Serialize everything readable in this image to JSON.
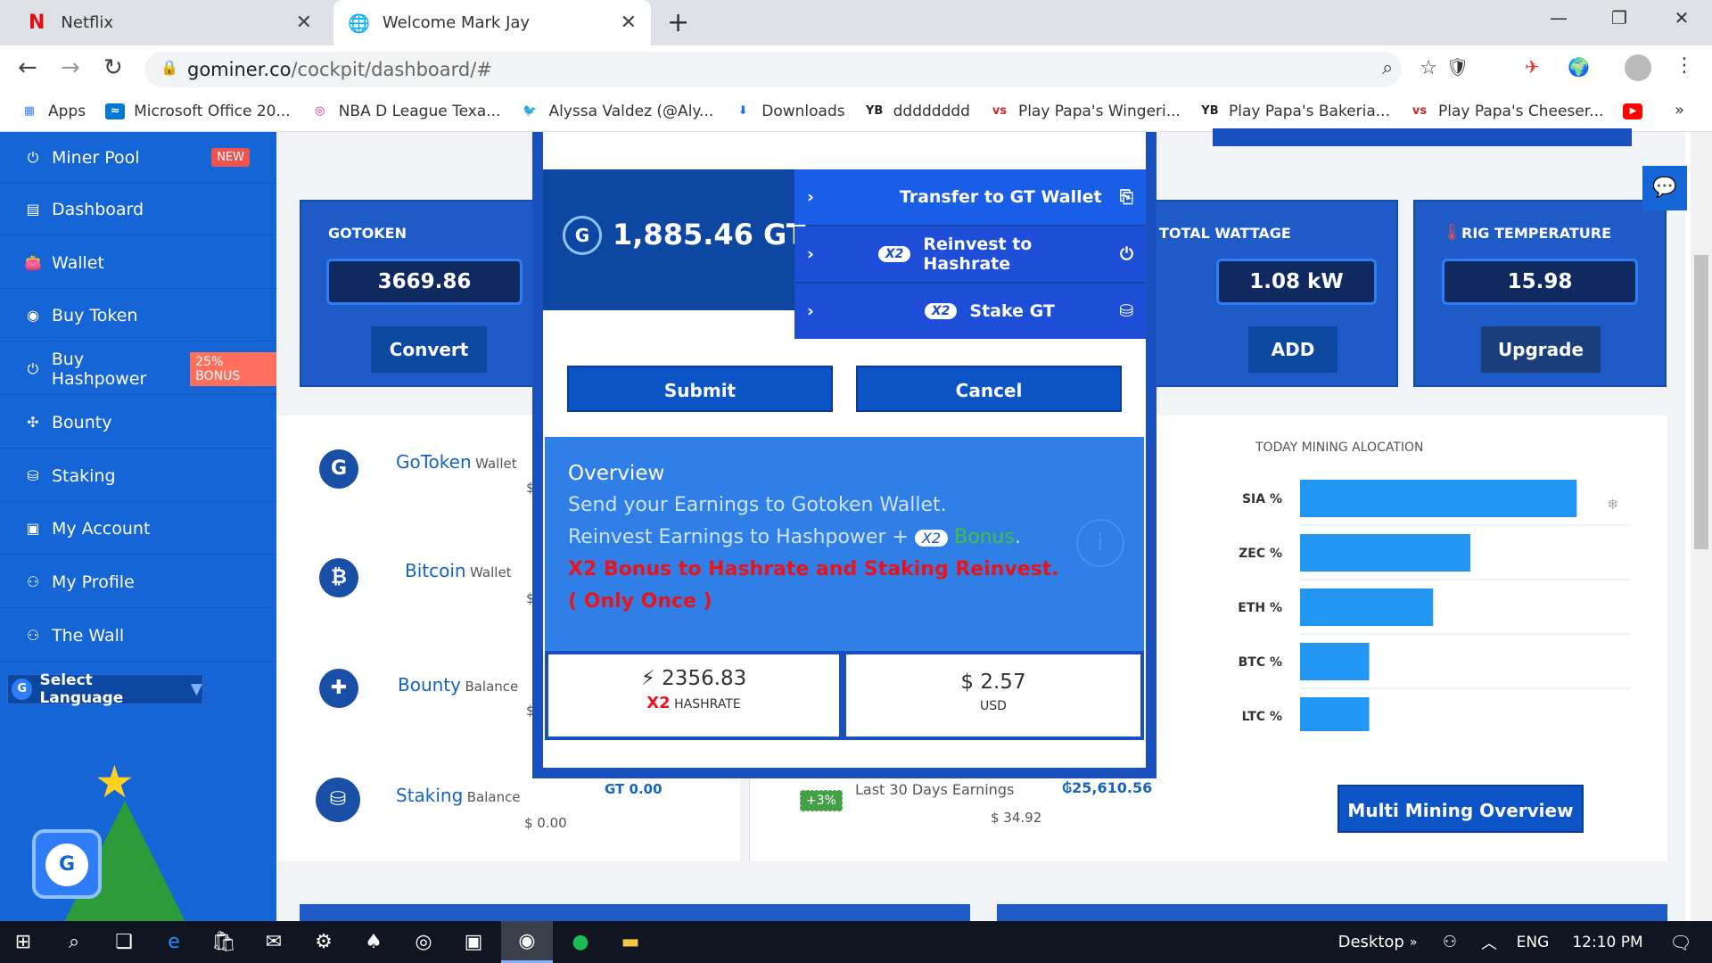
{
  "tabs": [
    {
      "title": "Netflix",
      "favicon": "N"
    },
    {
      "title": "Welcome Mark Jay"
    }
  ],
  "address": {
    "domain": "gominer.co",
    "path": "/cockpit/dashboard/#"
  },
  "bookmarks": [
    {
      "label": "Apps"
    },
    {
      "label": "Microsoft Office 20..."
    },
    {
      "label": "NBA D League Texa..."
    },
    {
      "label": "Alyssa Valdez (@Aly..."
    },
    {
      "label": "Downloads"
    },
    {
      "label": "dddddddd",
      "icon_text": "YB"
    },
    {
      "label": "Play Papa's Wingeri...",
      "icon_text": "vs"
    },
    {
      "label": "Play Papa's Bakeria...",
      "icon_text": "YB"
    },
    {
      "label": "Play Papa's Cheeser...",
      "icon_text": "vs"
    }
  ],
  "sidebar": {
    "items": [
      {
        "label": "Miner Pool",
        "badge": "NEW"
      },
      {
        "label": "Dashboard"
      },
      {
        "label": "Wallet"
      },
      {
        "label": "Buy Token"
      },
      {
        "label": "Buy Hashpower",
        "badge": "25% BONUS"
      },
      {
        "label": "Bounty"
      },
      {
        "label": "Staking"
      },
      {
        "label": "My Account"
      },
      {
        "label": "My Profile"
      },
      {
        "label": "The Wall"
      }
    ],
    "language": "Select Language"
  },
  "cards": {
    "gotoken": {
      "title": "GOTOKEN",
      "value": "3669.86",
      "button": "Convert"
    },
    "wattage": {
      "title": "TOTAL WATTAGE",
      "value": "1.08 kW",
      "button": "ADD"
    },
    "temperature": {
      "title": "RIG TEMPERATURE",
      "value": "15.98",
      "button": "Upgrade"
    }
  },
  "wallets": [
    {
      "name": "GoToken",
      "suffix": "Wallet",
      "amount_prefix": "$"
    },
    {
      "name": "Bitcoin",
      "suffix": "Wallet",
      "amount_prefix": "$"
    },
    {
      "name": "Bounty",
      "suffix": "Balance",
      "amount_prefix": "$"
    },
    {
      "name": "Staking",
      "suffix": "Balance",
      "amount": "$ 0.00",
      "gt": "GT 0.00"
    }
  ],
  "earnings": {
    "badge": "+3%",
    "label": "Last 30 Days Earnings",
    "gt": "₲25,610.56",
    "usd": "$ 34.92"
  },
  "allocation": {
    "title": "TODAY MINING ALOCATION",
    "button": "Multi Mining Overview"
  },
  "chart_data": {
    "type": "bar",
    "orientation": "horizontal",
    "categories": [
      "SIA %",
      "ZEC %",
      "ETH %",
      "BTC %",
      "LTC %"
    ],
    "values": [
      52,
      32,
      25,
      13,
      13
    ],
    "xlim": [
      0,
      62
    ],
    "color": "#2196f3"
  },
  "modal": {
    "balance": "1,885.46 GT",
    "options": [
      {
        "label": "Transfer to GT Wallet"
      },
      {
        "label": "Reinvest to Hashrate",
        "tag": "X2"
      },
      {
        "label": "Stake GT",
        "tag": "X2"
      }
    ],
    "submit": "Submit",
    "cancel": "Cancel",
    "overview": {
      "title": "Overview",
      "line1": "Send your Earnings to Gotoken Wallet.",
      "line2": "Reinvest Earnings to Hashpower +",
      "line2_tag": "X2",
      "line2_bonus": "Bonus",
      "line2_end": ".",
      "line3": "X2 Bonus to Hashrate and Staking Reinvest.",
      "line4": "( Only Once )"
    },
    "stats": {
      "hashrate_value": "2356.83",
      "hashrate_x2": "X2",
      "hashrate_label": "HASHRATE",
      "usd_value": "$ 2.57",
      "usd_label": "USD"
    }
  },
  "taskbar": {
    "desktop": "Desktop",
    "lang": "ENG",
    "time": "12:10 PM"
  },
  "colors": {
    "sidebar": "#1565d6",
    "card": "#1e5bc6",
    "modal_border": "#1a4fc0",
    "overview": "#2f7fe6",
    "red": "#e8141b",
    "green": "#43c03f"
  }
}
